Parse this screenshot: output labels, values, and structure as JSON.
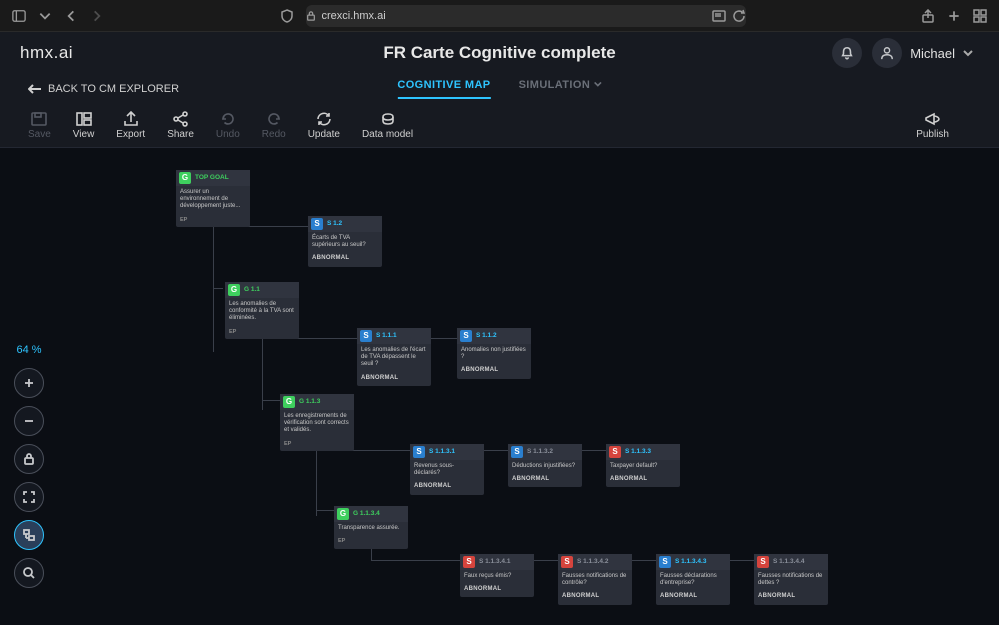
{
  "browser": {
    "url": "crexci.hmx.ai"
  },
  "app": {
    "logo": "hmx.ai",
    "title": "FR Carte Cognitive complete",
    "user": "Michael"
  },
  "nav": {
    "back": "BACK TO CM EXPLORER",
    "tabs": {
      "map": "COGNITIVE MAP",
      "simulation": "SIMULATION"
    }
  },
  "toolbar": {
    "save": "Save",
    "view": "View",
    "export": "Export",
    "share": "Share",
    "undo": "Undo",
    "redo": "Redo",
    "update": "Update",
    "datamodel": "Data model",
    "publish": "Publish"
  },
  "zoom": {
    "level": "64 %"
  },
  "nodes": {
    "top": {
      "badge": "G",
      "code": "TOP GOAL",
      "text": "Assurer un environnement de développement juste...",
      "ep": "EP"
    },
    "s12": {
      "badge": "S",
      "code": "S 1.2",
      "text": "Écarts de TVA supérieurs au seuil?",
      "status": "ABNORMAL"
    },
    "g11": {
      "badge": "G",
      "code": "G 1.1",
      "text": "Les anomalies de conformité à la TVA sont éliminées.",
      "ep": "EP"
    },
    "s111": {
      "badge": "S",
      "code": "S 1.1.1",
      "text": "Les anomalies de l'écart de TVA dépassent le seuil ?",
      "status": "ABNORMAL"
    },
    "s112": {
      "badge": "S",
      "code": "S 1.1.2",
      "text": "Anomalies non justifiées ?",
      "status": "ABNORMAL"
    },
    "g113": {
      "badge": "G",
      "code": "G 1.1.3",
      "text": "Les enregistrements de vérification sont corrects et validés.",
      "ep": "EP"
    },
    "s1131": {
      "badge": "S",
      "code": "S 1.1.3.1",
      "text": "Revenus sous-déclarés?",
      "status": "ABNORMAL"
    },
    "s1132": {
      "badge": "S",
      "code": "S 1.1.3.2",
      "text": "Déductions injustifiées?",
      "status": "ABNORMAL"
    },
    "s1133": {
      "badge": "S",
      "code": "S 1.1.3.3",
      "text": "Taxpayer default?",
      "status": "ABNORMAL"
    },
    "g1134": {
      "badge": "G",
      "code": "G 1.1.3.4",
      "text": "Transparence assurée.",
      "ep": "EP"
    },
    "s11341": {
      "badge": "S",
      "code": "S 1.1.3.4.1",
      "text": "Faux reçus émis?",
      "status": "ABNORMAL"
    },
    "s11342": {
      "badge": "S",
      "code": "S 1.1.3.4.2",
      "text": "Fausses notifications de contrôle?",
      "status": "ABNORMAL"
    },
    "s11343": {
      "badge": "S",
      "code": "S 1.1.3.4.3",
      "text": "Fausses déclarations d'entreprise?",
      "status": "ABNORMAL"
    },
    "s11344": {
      "badge": "S",
      "code": "S 1.1.3.4.4",
      "text": "Fausses notifications de dettes ?",
      "status": "ABNORMAL"
    }
  }
}
